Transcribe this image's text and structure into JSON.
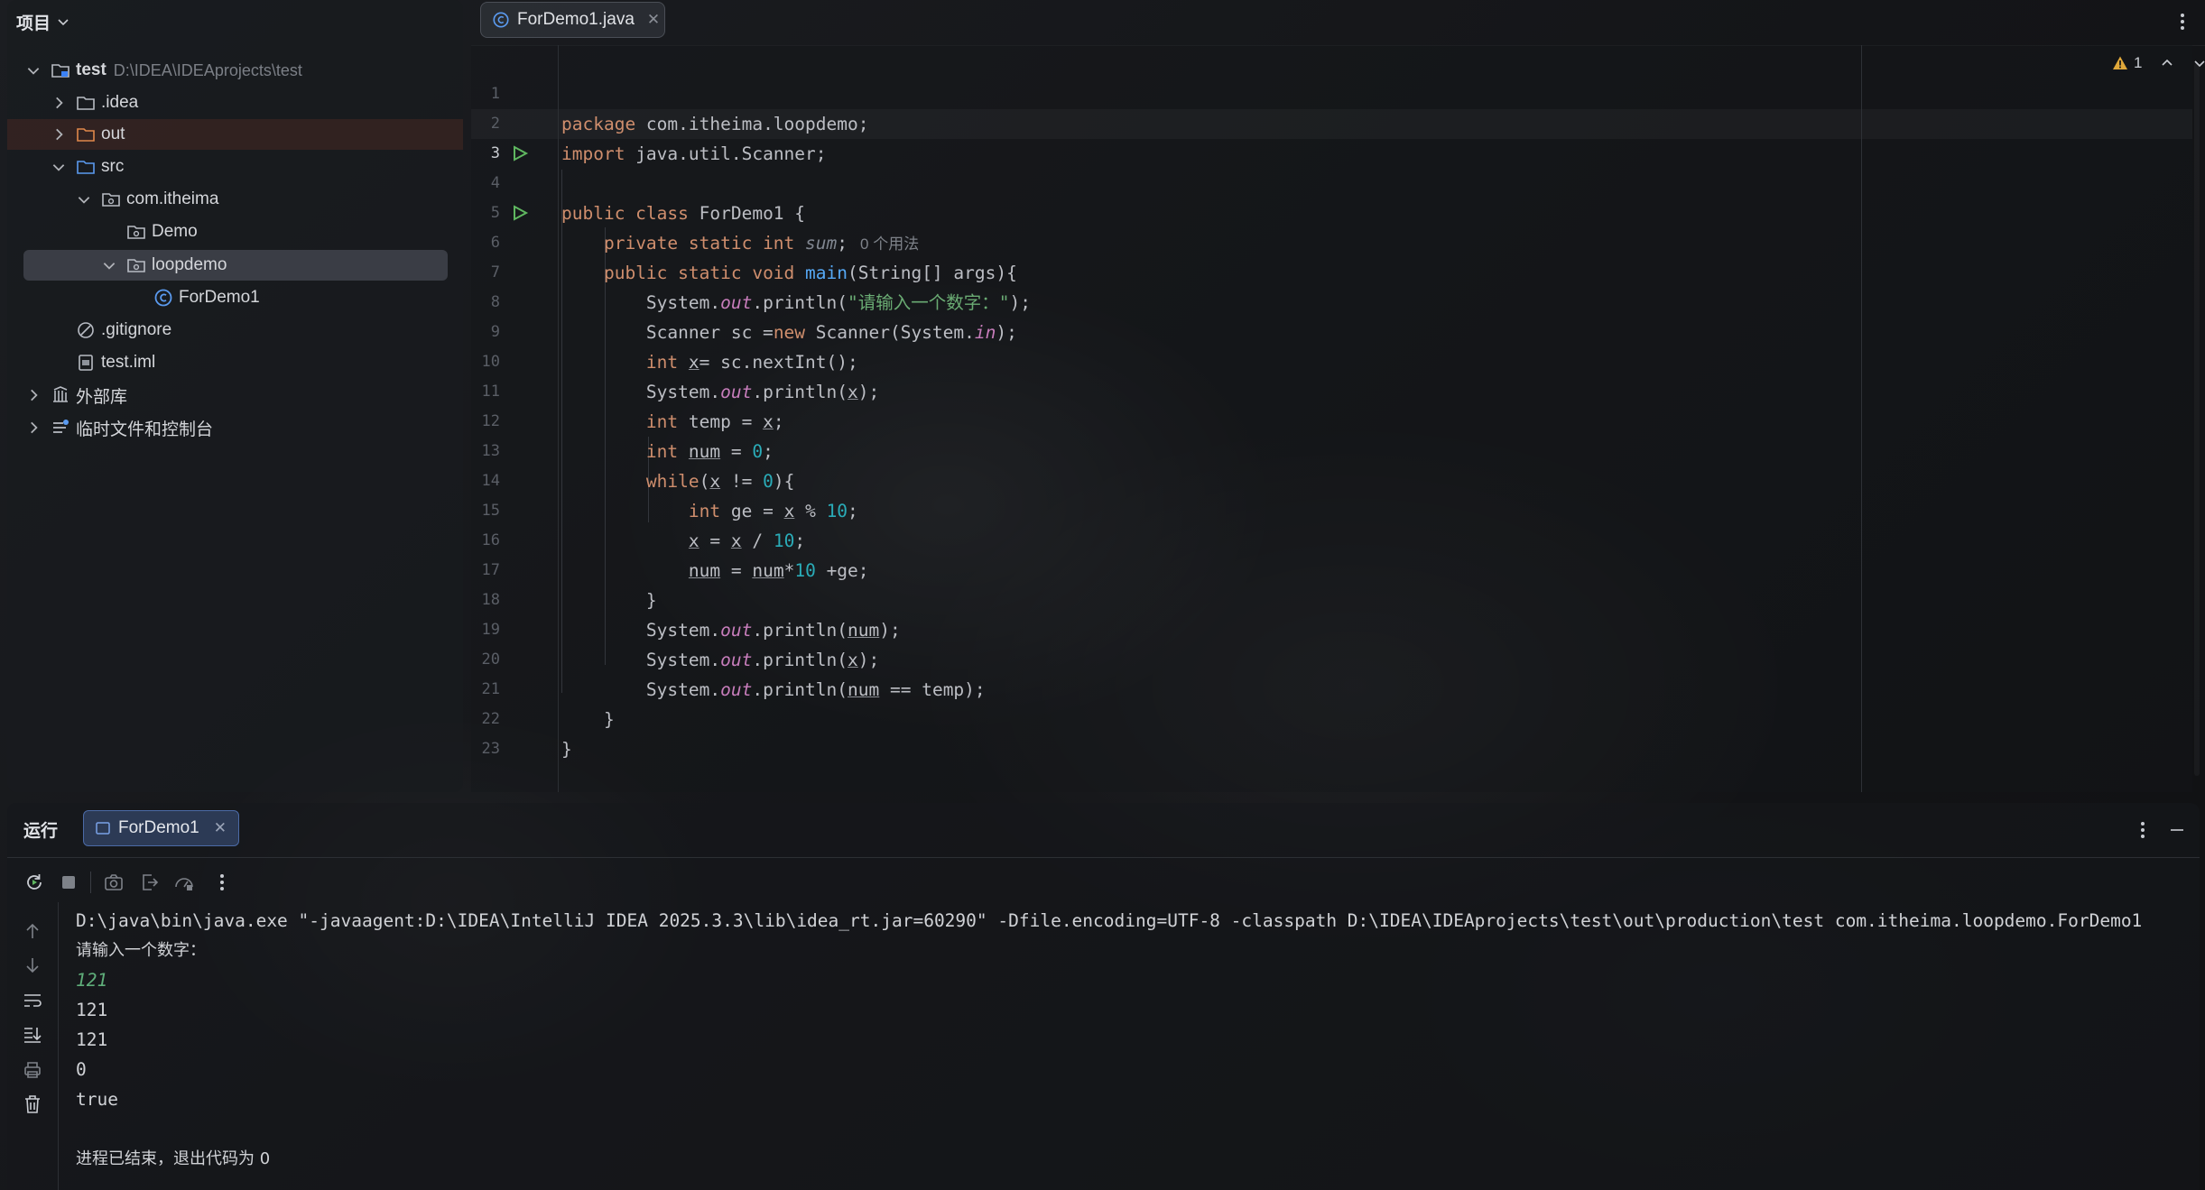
{
  "project_panel": {
    "title": "项目",
    "tree": [
      {
        "label": "test",
        "path": "D:\\IDEA\\IDEAprojects\\test"
      },
      {
        "label": ".idea"
      },
      {
        "label": "out"
      },
      {
        "label": "src"
      },
      {
        "label": "com.itheima"
      },
      {
        "label": "Demo"
      },
      {
        "label": "loopdemo"
      },
      {
        "label": "ForDemo1"
      },
      {
        "label": ".gitignore"
      },
      {
        "label": "test.iml"
      },
      {
        "label": "外部库"
      },
      {
        "label": "临时文件和控制台"
      }
    ]
  },
  "editor": {
    "tab_label": "ForDemo1.java",
    "warning_count": "1",
    "usage_hint": "0 个用法",
    "line_numbers": [
      "1",
      "2",
      "3",
      "4",
      "5",
      "6",
      "7",
      "8",
      "9",
      "10",
      "11",
      "12",
      "13",
      "14",
      "15",
      "16",
      "17",
      "18",
      "19",
      "20",
      "21",
      "22",
      "23"
    ]
  },
  "run_panel": {
    "title": "运行",
    "tab_label": "ForDemo1",
    "console": [
      "D:\\java\\bin\\java.exe \"-javaagent:D:\\IDEA\\IntelliJ IDEA 2025.3.3\\lib\\idea_rt.jar=60290\" -Dfile.encoding=UTF-8 -classpath D:\\IDEA\\IDEAprojects\\test\\out\\production\\test com.itheima.loopdemo.ForDemo1",
      "请输入一个数字：",
      "121",
      "121",
      "121",
      "0",
      "true",
      "",
      "进程已结束，退出代码为 0"
    ]
  },
  "colors": {
    "keyword": "#cf8e6d",
    "method": "#56a8f5",
    "string": "#6aab73",
    "number": "#2aacb8",
    "static_field": "#c77dbb",
    "console_input": "#5fae7a",
    "selection": "#3a3d45"
  }
}
